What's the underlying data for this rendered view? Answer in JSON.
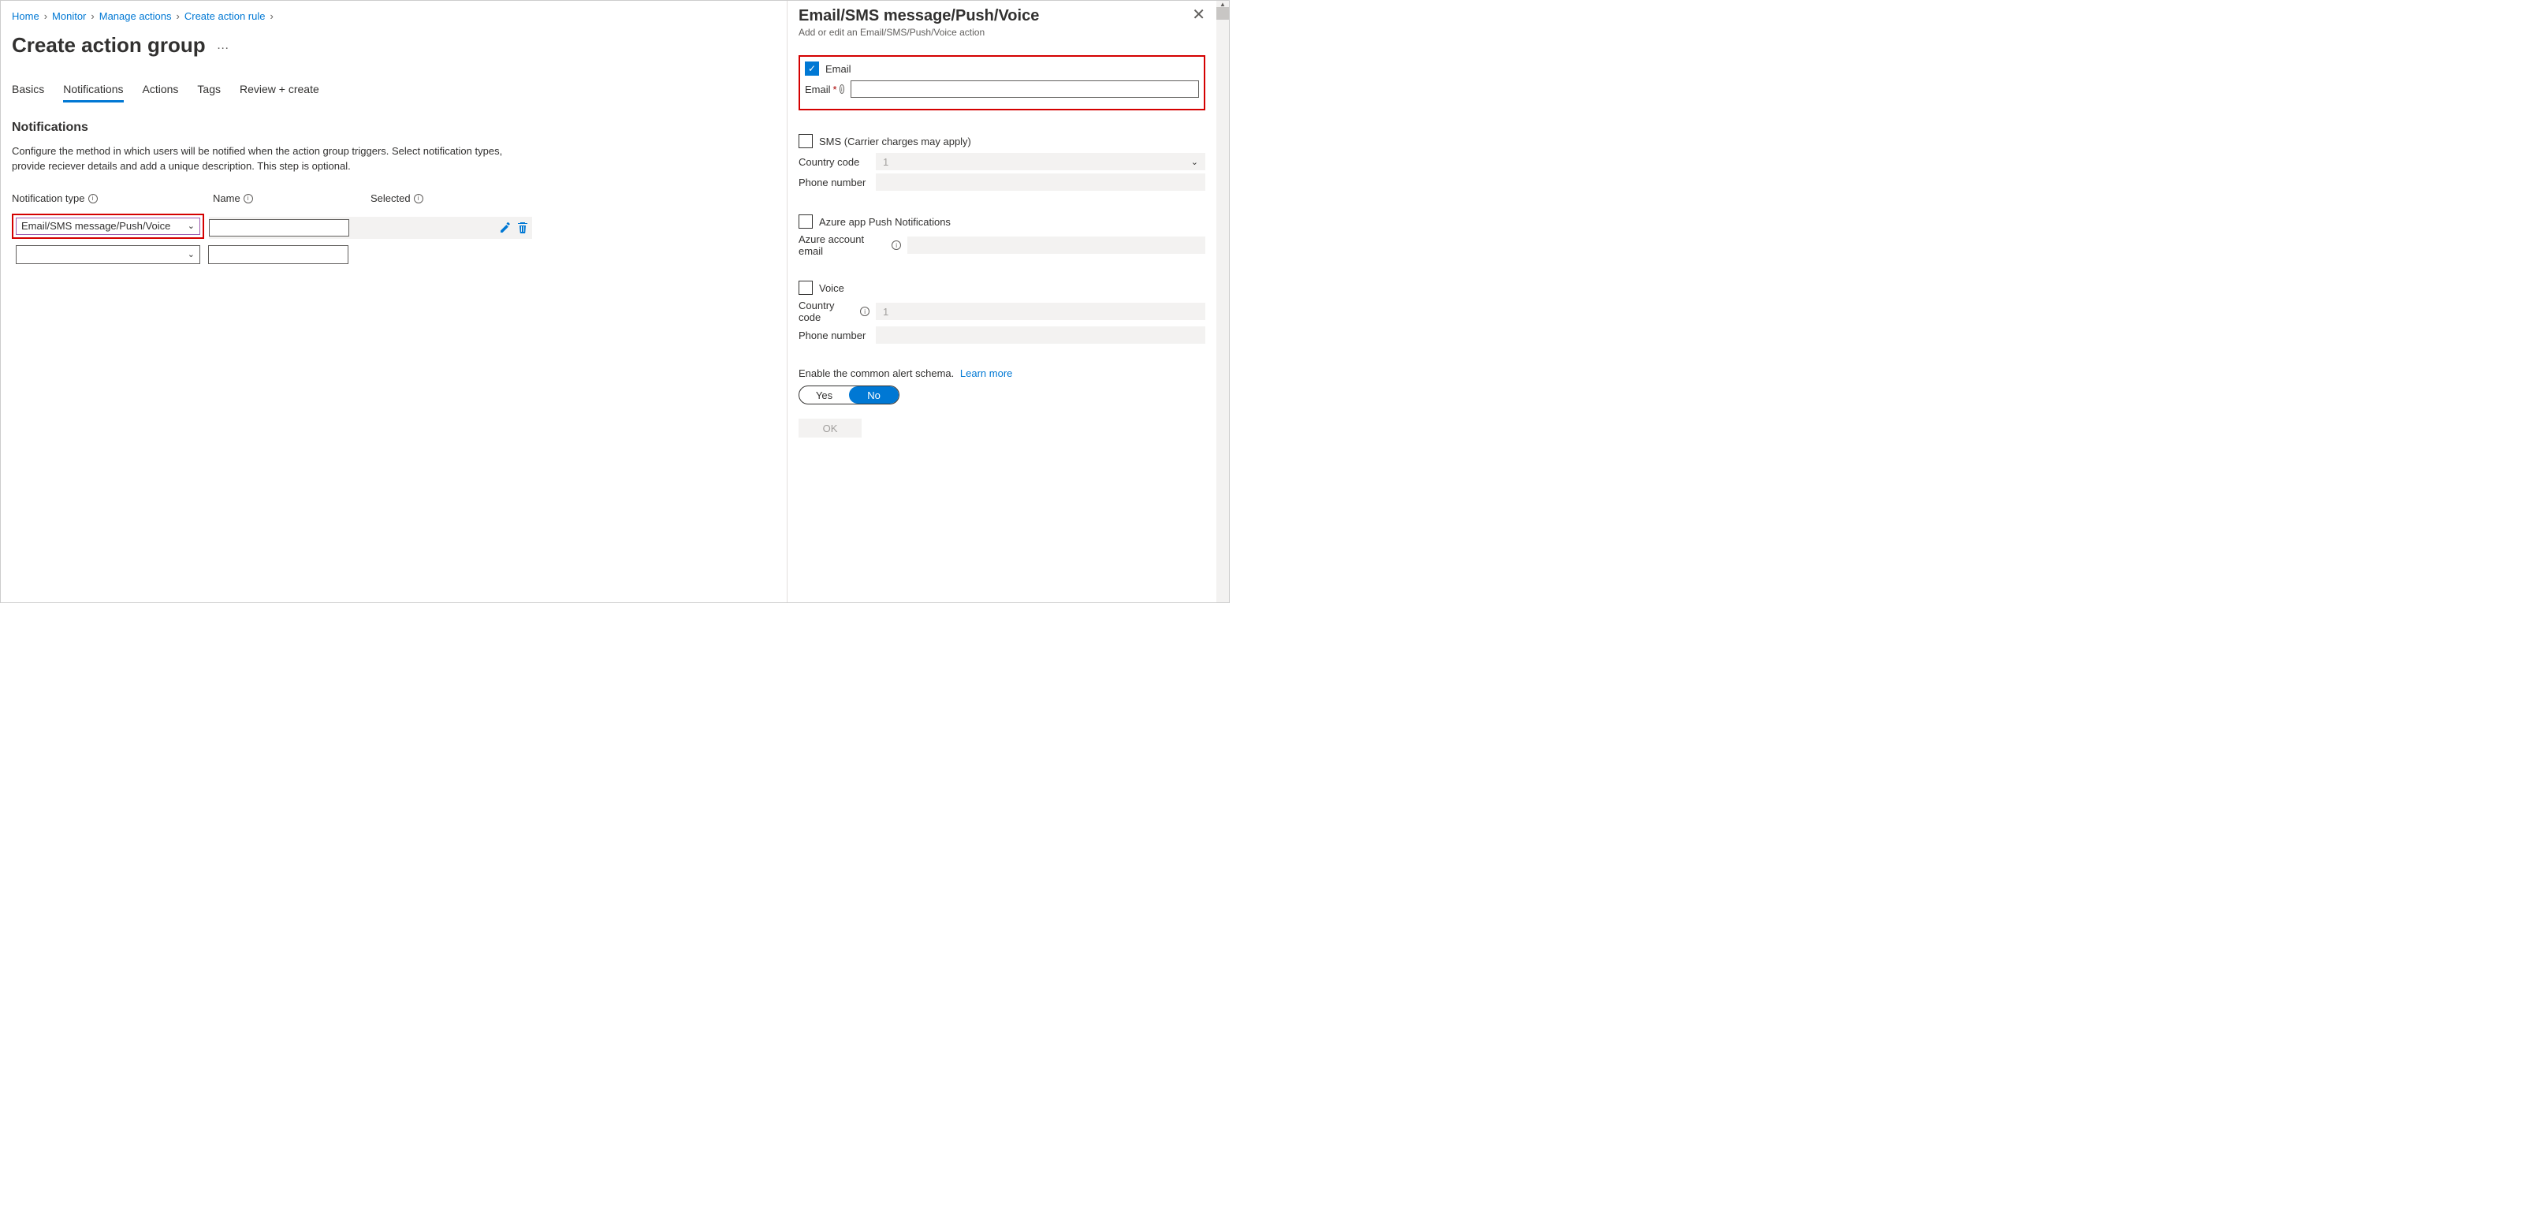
{
  "breadcrumb": [
    "Home",
    "Monitor",
    "Manage actions",
    "Create action rule"
  ],
  "page_title": "Create action group",
  "tabs": [
    "Basics",
    "Notifications",
    "Actions",
    "Tags",
    "Review + create"
  ],
  "active_tab": 1,
  "section": {
    "heading": "Notifications",
    "description": "Configure the method in which users will be notified when the action group triggers. Select notification types, provide reciever details and add a unique description. This step is optional."
  },
  "columns": {
    "type": "Notification type",
    "name": "Name",
    "selected": "Selected"
  },
  "row1_type_value": "Email/SMS message/Push/Voice",
  "flyout": {
    "title": "Email/SMS message/Push/Voice",
    "subtitle": "Add or edit an Email/SMS/Push/Voice action",
    "email_chk_label": "Email",
    "email_field_label": "Email",
    "sms_chk_label": "SMS (Carrier charges may apply)",
    "country_code_label": "Country code",
    "country_code_value": "1",
    "phone_label": "Phone number",
    "push_chk_label": "Azure app Push Notifications",
    "push_field_label": "Azure account email",
    "voice_chk_label": "Voice",
    "voice_country_code_value": "1",
    "schema_text": "Enable the common alert schema.",
    "schema_link": "Learn more",
    "toggle_yes": "Yes",
    "toggle_no": "No",
    "ok": "OK"
  }
}
